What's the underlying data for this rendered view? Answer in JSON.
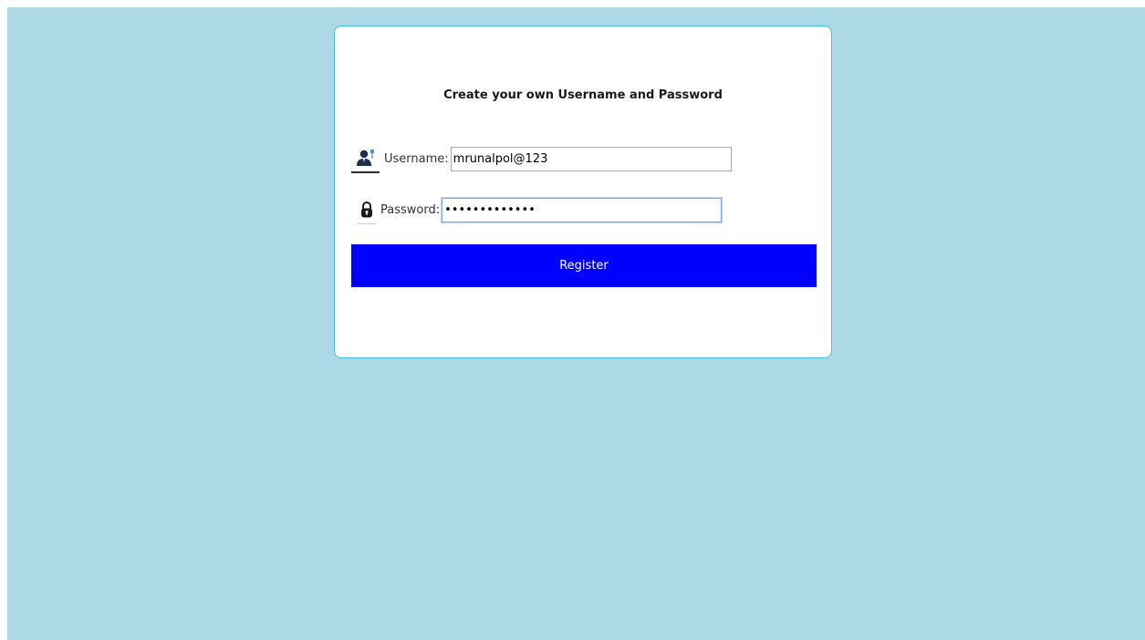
{
  "form": {
    "title": "Create your own Username and Password",
    "username": {
      "label": "Username:",
      "value": "mrunalpol@123",
      "icon": "user-icon"
    },
    "password": {
      "label": "Password:",
      "value": "mrunalpol@123",
      "icon": "lock-icon"
    },
    "register_label": "Register"
  },
  "colors": {
    "background": "#add8e6",
    "card_border": "#40c0dc",
    "button": "#0000ff",
    "button_text": "#ffffff"
  }
}
